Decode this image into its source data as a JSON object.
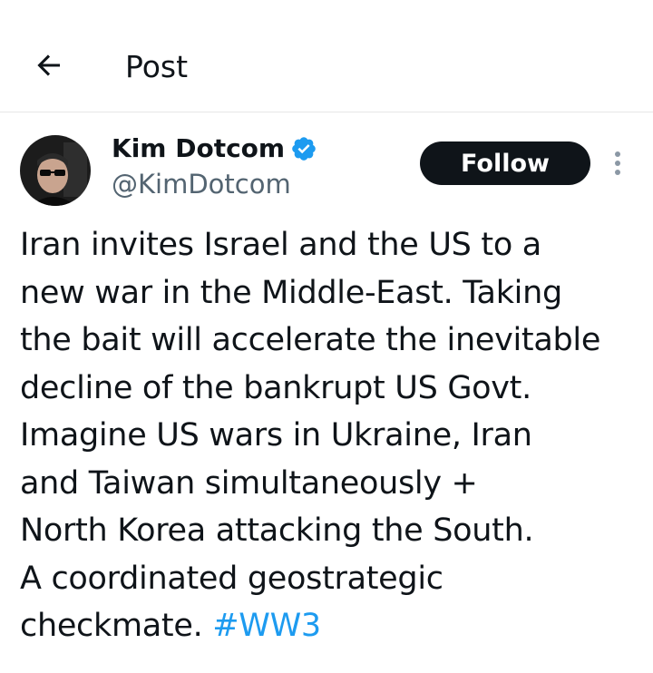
{
  "header": {
    "title": "Post"
  },
  "author": {
    "display_name": "Kim Dotcom",
    "handle": "@KimDotcom",
    "verified": true,
    "follow_label": "Follow"
  },
  "tweet": {
    "lines": [
      "Iran invites Israel and the US to a",
      "new war in the Middle-East. Taking",
      "the bait will accelerate the inevitable",
      "decline of the bankrupt US Govt.",
      "Imagine US wars in Ukraine, Iran",
      "and Taiwan simultaneously +",
      "North Korea attacking the South.",
      "A coordinated geostrategic",
      "checkmate. "
    ],
    "hashtag": "#WW3"
  },
  "colors": {
    "accent": "#1d9bf0",
    "text": "#0f1419",
    "secondary": "#536471",
    "follow_bg": "#0f1419"
  },
  "icons": {
    "back": "arrow-left-icon",
    "verified": "verified-badge-icon",
    "more": "more-vertical-icon"
  }
}
